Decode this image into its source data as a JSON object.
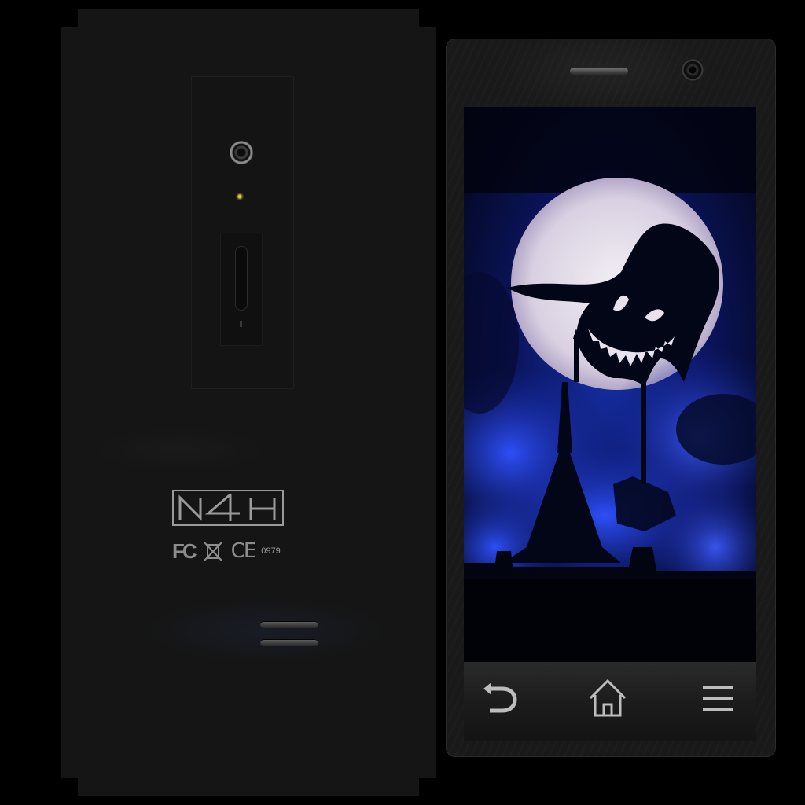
{
  "back_view": {
    "brand_logo": "N4H",
    "certifications": {
      "fcc": "FC",
      "weee": "crossed-out-bin-icon",
      "ce": "CE",
      "notified_body": "0979"
    }
  },
  "front_view": {
    "wallpaper": "moonlit-night-scene-with-boogeyman-silhouette",
    "nav_bar": {
      "back": "back-arrow-icon",
      "home": "home-icon",
      "menu": "menu-icon"
    }
  },
  "colors": {
    "background": "#000000",
    "skin": "#151515",
    "screen_blue": "#1e3cc8",
    "moon": "#dcd6e6"
  }
}
